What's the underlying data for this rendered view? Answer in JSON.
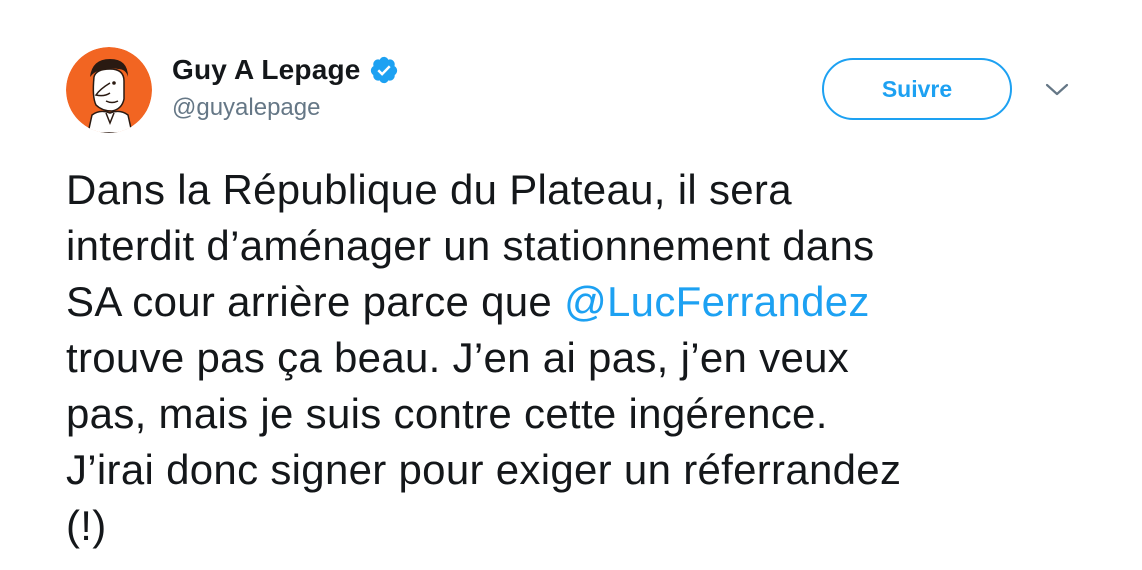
{
  "user": {
    "display_name": "Guy A Lepage",
    "handle": "@guyalepage",
    "verified": true,
    "avatar_icon": "cartoon-portrait-avatar"
  },
  "follow_button": {
    "label": "Suivre"
  },
  "menu": {
    "icon": "chevron-down-icon"
  },
  "tweet": {
    "line1": "Dans la République du Plateau, il sera",
    "line2": "interdit d’aménager un stationnement dans",
    "line3_before": "SA cour arrière parce que ",
    "mention": "@LucFerrandez",
    "line4": "trouve pas ça beau. J’en ai pas, j’en veux",
    "line5": "pas, mais je suis contre cette ingérence.",
    "line6": "J’irai donc signer pour exiger un réferrandez",
    "line7": "(!)"
  },
  "colors": {
    "accent": "#1da1f2",
    "text": "#14171a",
    "secondary": "#657786",
    "avatar_bg": "#f26522"
  }
}
